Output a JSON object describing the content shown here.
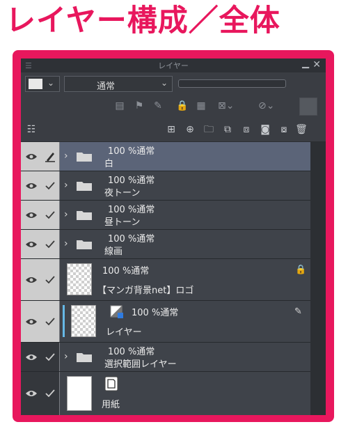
{
  "heading": "レイヤー構成／全体",
  "colors": {
    "accent": "#e8175d",
    "panel": "#3f434a",
    "selected_row": "#5b6478"
  },
  "panel": {
    "title": "レイヤー",
    "blend_mode": "通常",
    "layers": [
      {
        "name": "白",
        "opacity_mode": "100 %通常",
        "type": "folder",
        "selected": true,
        "visible": true,
        "pen_icon": true
      },
      {
        "name": "夜トーン",
        "opacity_mode": "100 %通常",
        "type": "folder",
        "visible": true
      },
      {
        "name": "昼トーン",
        "opacity_mode": "100 %通常",
        "type": "folder",
        "visible": true
      },
      {
        "name": "線画",
        "opacity_mode": "100 %通常",
        "type": "folder",
        "visible": true
      },
      {
        "name": "【マンガ背景net】ロゴ",
        "opacity_mode": "100 %通常",
        "type": "raster",
        "locked": true,
        "visible": true
      },
      {
        "name": "レイヤー",
        "opacity_mode": "100 %通常",
        "type": "tone-raster",
        "visible": true
      },
      {
        "name": "選択範囲レイヤー",
        "opacity_mode": "100 %通常",
        "type": "folder",
        "visible": true
      },
      {
        "name": "用紙",
        "type": "paper",
        "visible": true
      }
    ]
  }
}
